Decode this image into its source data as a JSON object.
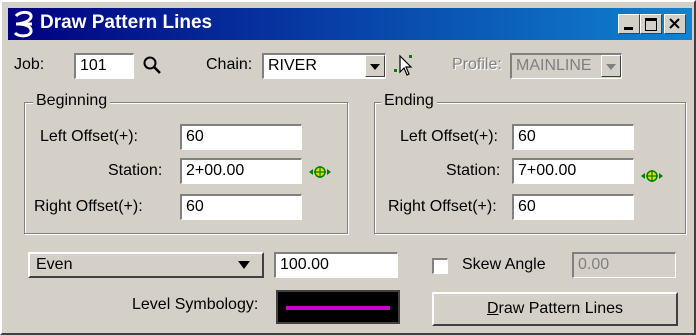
{
  "window": {
    "title": "Draw Pattern Lines"
  },
  "top": {
    "job_label": "Job:",
    "job_value": "101",
    "chain_label": "Chain:",
    "chain_value": "RIVER",
    "profile_label": "Profile:",
    "profile_value": "MAINLINE"
  },
  "beginning": {
    "title": "Beginning",
    "left_offset_label": "Left Offset(+):",
    "left_offset": "60",
    "station_label": "Station:",
    "station": "2+00.00",
    "right_offset_label": "Right Offset(+):",
    "right_offset": "60"
  },
  "ending": {
    "title": "Ending",
    "left_offset_label": "Left Offset(+):",
    "left_offset": "60",
    "station_label": "Station:",
    "station": "7+00.00",
    "right_offset_label": "Right Offset(+):",
    "right_offset": "60"
  },
  "bottom": {
    "mode_value": "Even",
    "spacing_value": "100.00",
    "skew_label": "Skew Angle",
    "skew_value": "0.00",
    "level_symbology_label": "Level Symbology:",
    "symbology_color": "#cc00cc",
    "draw_button_prefix": "D",
    "draw_button_rest": "raw Pattern Lines"
  }
}
